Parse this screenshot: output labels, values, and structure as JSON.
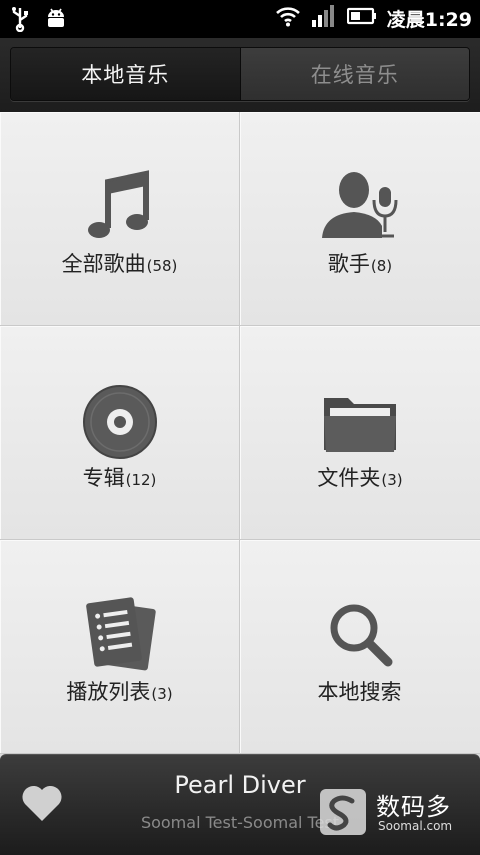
{
  "status_bar": {
    "time": "凌晨1:29",
    "icons": [
      "usb-icon",
      "android-debug-icon",
      "wifi-icon",
      "signal-icon",
      "battery-icon"
    ]
  },
  "tabs": [
    {
      "label": "本地音乐",
      "active": true
    },
    {
      "label": "在线音乐",
      "active": false
    }
  ],
  "categories": [
    {
      "label": "全部歌曲",
      "count": "(58)",
      "icon": "music-note-icon"
    },
    {
      "label": "歌手",
      "count": "(8)",
      "icon": "singer-microphone-icon"
    },
    {
      "label": "专辑",
      "count": "(12)",
      "icon": "album-disc-icon"
    },
    {
      "label": "文件夹",
      "count": "(3)",
      "icon": "folder-icon"
    },
    {
      "label": "播放列表",
      "count": "(3)",
      "icon": "playlist-icon"
    },
    {
      "label": "本地搜索",
      "count": "",
      "icon": "search-icon"
    }
  ],
  "now_playing": {
    "title": "Pearl Diver",
    "subtitle": "Soomal Test-Soomal Test"
  },
  "watermark": {
    "text": "数码多",
    "sub": "Soomal.com"
  },
  "colors": {
    "header_bg": "#1f1f1f",
    "grid_bg": "#ececec",
    "icon_color": "#555555"
  }
}
